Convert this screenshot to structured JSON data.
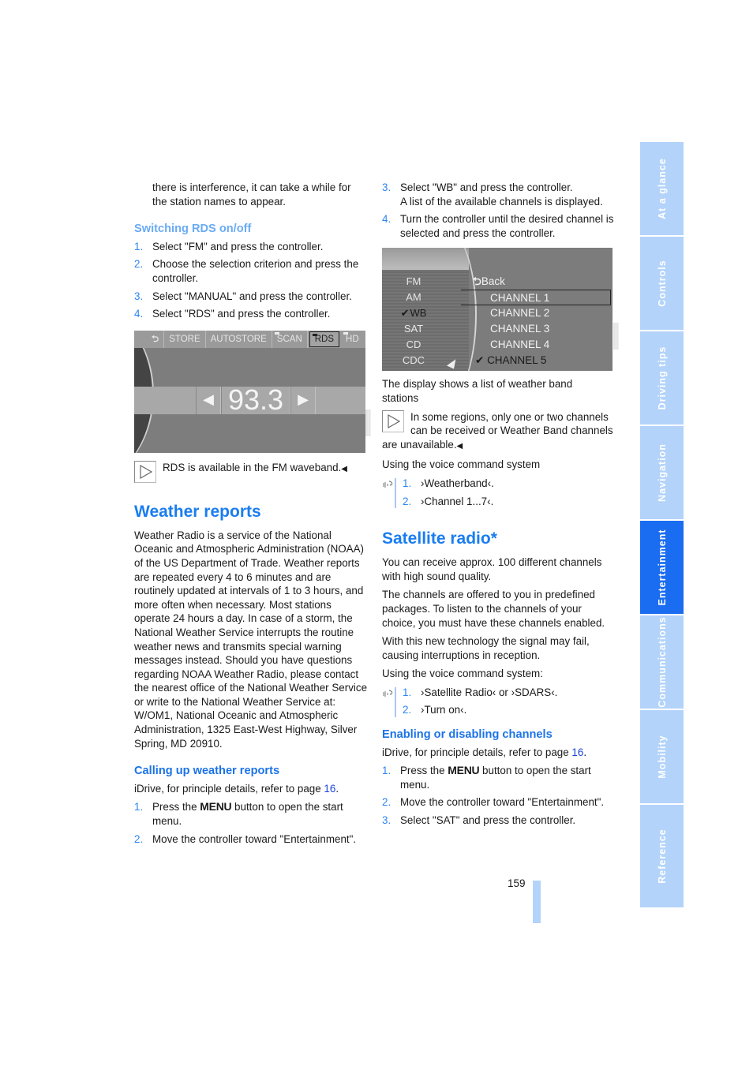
{
  "left_column": {
    "intro_text": "there is interference, it can take a while for the station names to appear.",
    "rds_heading": "Switching RDS on/off",
    "rds_steps": [
      {
        "num": "1.",
        "text": "Select \"FM\" and press the controller."
      },
      {
        "num": "2.",
        "text": "Choose the selection criterion and press the controller."
      },
      {
        "num": "3.",
        "text": "Select \"MANUAL\" and press the controller."
      },
      {
        "num": "4.",
        "text": "Select \"RDS\" and press the controller."
      }
    ],
    "radio_screen": {
      "buttons": [
        "STORE",
        "AUTOSTORE",
        "SCAN",
        "RDS",
        "HD"
      ],
      "selected": "RDS",
      "frequency": "93.3",
      "prev_arrow": "◀",
      "next_arrow": "▶"
    },
    "rds_note": "RDS is available in the FM waveband.",
    "weather_heading": "Weather reports",
    "weather_body": "Weather Radio is a service of the National Oceanic and Atmospheric Administration (NOAA) of the US Department of Trade. Weather reports are repeated every 4 to 6 minutes and are routinely updated at intervals of 1 to 3 hours, and more often when necessary. Most stations operate 24 hours a day. In case of a storm, the National Weather Service interrupts the routine weather news and transmits special warning messages instead. Should you have questions regarding NOAA Weather Radio, please contact the nearest office of the National Weather Service or write to the National Weather Service at: W/OM1, National Oceanic and Atmospheric Administration, 1325 East-West Highway, Silver Spring, MD 20910.",
    "calling_heading": "Calling up weather reports",
    "calling_intro": "iDrive, for principle details, refer to page ",
    "calling_page_link": "16",
    "calling_steps": [
      {
        "num": "1.",
        "pre": "Press the ",
        "key": "MENU",
        "post": " button to open the start menu."
      },
      {
        "num": "2.",
        "text": "Move the controller toward \"Entertainment\"."
      }
    ]
  },
  "right_column": {
    "wb_steps": [
      {
        "num": "3.",
        "text": "Select \"WB\" and press the controller.",
        "sub": "A list of the available channels is displayed."
      },
      {
        "num": "4.",
        "text": "Turn the controller until the desired channel is selected and press the controller."
      }
    ],
    "wb_screen": {
      "bands": [
        "FM",
        "AM",
        "WB",
        "SAT",
        "CD",
        "CDC"
      ],
      "active_band": "WB",
      "back_label": "Back",
      "channels": [
        "CHANNEL 1",
        "CHANNEL 2",
        "CHANNEL 3",
        "CHANNEL 4",
        "CHANNEL 5"
      ],
      "highlighted_channel": "CHANNEL 1",
      "checked_channel": "CHANNEL 5"
    },
    "wb_caption": "The display shows a list of weather band stations",
    "wb_note": "In some regions, only one or two channels can be received or Weather Band channels are unavailable.",
    "voice_intro_1": "Using the voice command system",
    "voice_cmds_1": [
      {
        "num": "1.",
        "text": "›Weatherband‹."
      },
      {
        "num": "2.",
        "text": "›Channel 1...7‹."
      }
    ],
    "sat_heading": "Satellite radio*",
    "sat_p1": "You can receive approx. 100 different channels with high sound quality.",
    "sat_p2": "The channels are offered to you in predefined packages. To listen to the channels of your choice, you must have these channels enabled.",
    "sat_p3": "With this new technology the signal may fail, causing interruptions in reception.",
    "voice_intro_2": "Using the voice command system:",
    "voice_cmds_2": [
      {
        "num": "1.",
        "text": "›Satellite Radio‹ or ›SDARS‹."
      },
      {
        "num": "2.",
        "text": "›Turn on‹."
      }
    ],
    "enable_heading": "Enabling or disabling channels",
    "enable_intro": "iDrive, for principle details, refer to page ",
    "enable_page_link": "16",
    "enable_steps": [
      {
        "num": "1.",
        "pre": "Press the ",
        "key": "MENU",
        "post": " button to open the start menu."
      },
      {
        "num": "2.",
        "text": "Move the controller toward \"Entertainment\"."
      },
      {
        "num": "3.",
        "text": "Select \"SAT\" and press the controller."
      }
    ]
  },
  "side_tabs": [
    {
      "label": "At a glance",
      "active": false
    },
    {
      "label": "Controls",
      "active": false
    },
    {
      "label": "Driving tips",
      "active": false
    },
    {
      "label": "Navigation",
      "active": false
    },
    {
      "label": "Entertainment",
      "active": true
    },
    {
      "label": "Communications",
      "active": false
    },
    {
      "label": "Mobility",
      "active": false
    },
    {
      "label": "Reference",
      "active": false
    }
  ],
  "page_number": "159",
  "end_mark": "◀",
  "colors": {
    "heading_blue": "#1a7df0",
    "tab_light": "#b3d3fa",
    "tab_active": "#1a6cf0"
  }
}
